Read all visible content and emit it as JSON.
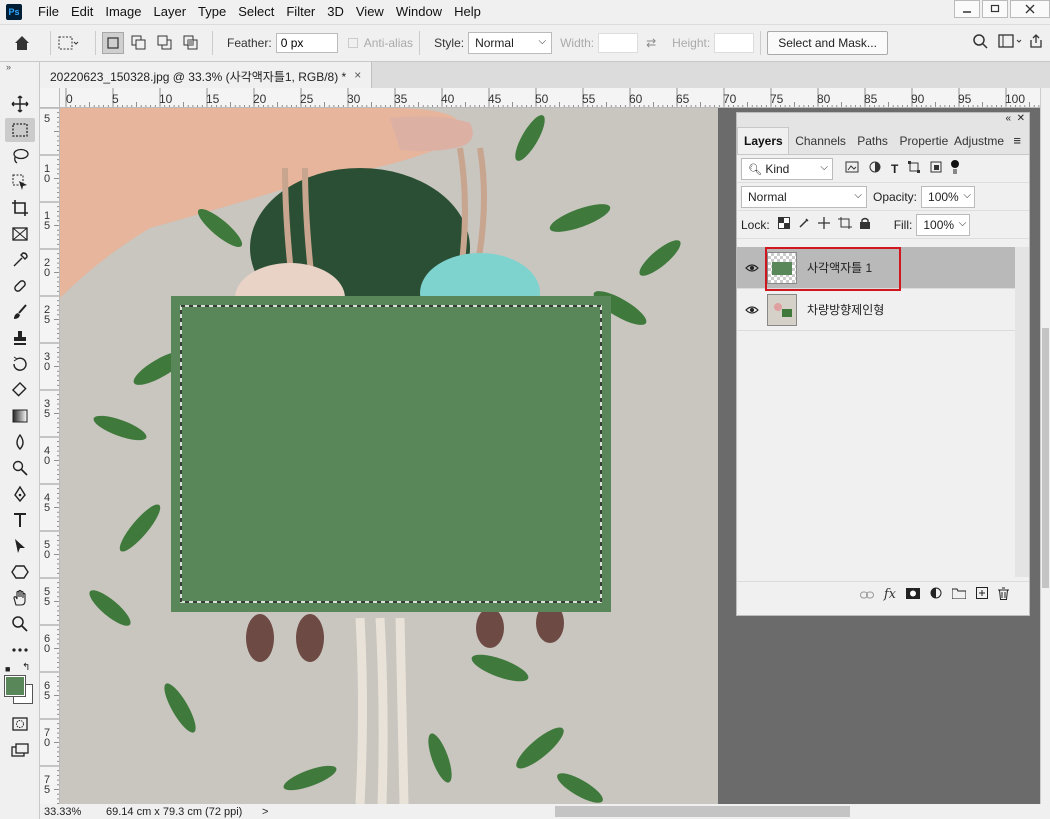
{
  "app": {
    "logo": "Ps"
  },
  "menu": [
    "File",
    "Edit",
    "Image",
    "Layer",
    "Type",
    "Select",
    "Filter",
    "3D",
    "View",
    "Window",
    "Help"
  ],
  "options": {
    "feather_label": "Feather:",
    "feather_value": "0 px",
    "antialias_label": "Anti-alias",
    "style_label": "Style:",
    "style_value": "Normal",
    "width_label": "Width:",
    "height_label": "Height:",
    "select_mask_label": "Select and Mask..."
  },
  "document": {
    "tab_title": "20220623_150328.jpg @ 33.3% (사각액자틀1, RGB/8) *",
    "close_glyph": "×"
  },
  "rulers": {
    "top": [
      "0",
      "5",
      "10",
      "15",
      "20",
      "25",
      "30",
      "35",
      "40",
      "45",
      "50",
      "55",
      "60",
      "65",
      "70",
      "75",
      "80",
      "85",
      "90",
      "95",
      "100"
    ],
    "left": [
      "5",
      "1\n0",
      "1\n5",
      "2\n0",
      "2\n5",
      "3\n0",
      "3\n5",
      "4\n0",
      "4\n5",
      "5\n0",
      "5\n5",
      "6\n0",
      "6\n5",
      "7\n0",
      "7\n5"
    ]
  },
  "status": {
    "zoom": "33.33%",
    "doc_size": "69.14 cm x 79.3 cm (72 ppi)",
    "arrow": ">"
  },
  "layers_panel": {
    "tabs": [
      "Layers",
      "Channels",
      "Paths",
      "Propertie",
      "Adjustme"
    ],
    "filter_kind": "Kind",
    "blend_mode": "Normal",
    "opacity_label": "Opacity:",
    "opacity_value": "100%",
    "lock_label": "Lock:",
    "fill_label": "Fill:",
    "fill_value": "100%",
    "layers": [
      {
        "name": "사각액자틀 1",
        "selected": true
      },
      {
        "name": "차량방향제인형",
        "selected": false
      }
    ]
  },
  "colors": {
    "fill_green": "#5a875a",
    "foreground": "#5a875a",
    "highlight_red": "#d0161e"
  }
}
